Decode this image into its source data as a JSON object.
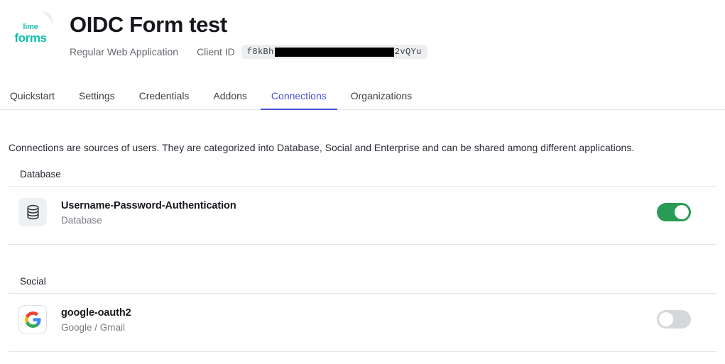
{
  "header": {
    "logo": {
      "line1": "lime",
      "line2": "forms",
      "alt": "lime-forms-logo"
    },
    "title": "OIDC Form test",
    "app_type": "Regular Web Application",
    "client_id_label": "Client ID",
    "client_id_prefix": "f8kBh",
    "client_id_suffix": "2vQYu"
  },
  "tabs": [
    {
      "label": "Quickstart",
      "active": false
    },
    {
      "label": "Settings",
      "active": false
    },
    {
      "label": "Credentials",
      "active": false
    },
    {
      "label": "Addons",
      "active": false
    },
    {
      "label": "Connections",
      "active": true
    },
    {
      "label": "Organizations",
      "active": false
    }
  ],
  "main": {
    "intro": "Connections are sources of users. They are categorized into Database, Social and Enterprise and can be shared among different applications.",
    "sections": [
      {
        "heading": "Database",
        "rows": [
          {
            "name": "Username-Password-Authentication",
            "subtitle": "Database",
            "icon": "database-icon",
            "enabled": true
          }
        ]
      },
      {
        "heading": "Social",
        "rows": [
          {
            "name": "google-oauth2",
            "subtitle": "Google / Gmail",
            "icon": "google-icon",
            "enabled": false
          }
        ]
      }
    ]
  },
  "colors": {
    "accent_blue": "#4a51d8",
    "toggle_on_green": "#2a9b55",
    "toggle_off_gray": "#d5d7da",
    "brand_teal": "#0bbfad",
    "divider": "#e4e6e8"
  }
}
